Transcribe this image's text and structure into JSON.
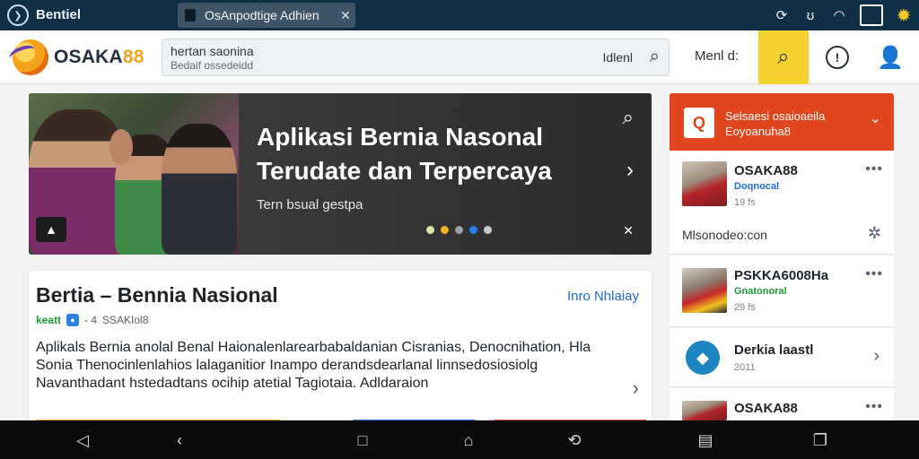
{
  "statusbar": {
    "app_name": "Bentiel",
    "tab_title": "OsAnpodtige Adhien",
    "tab_close": "✕"
  },
  "header": {
    "logo_main": "OSAKA",
    "logo_num": "88",
    "search_line1": "hertan saonina",
    "search_line2": "Bedaif ossedeidd",
    "search_label": "Idlenl",
    "menu_label": "Menl d:"
  },
  "hero": {
    "title": "Aplikasi Bernia Nasonal Terudate dan Terpercaya",
    "subtitle": "Tern bsual gestpa",
    "dot_colors": [
      "#d8e7b0",
      "#f2b31e",
      "#9aa3aa",
      "#2a7fe3",
      "#c7ccd1"
    ]
  },
  "article": {
    "title": "Bertia – Bennia Nasional",
    "more": "Inro Nhlaiay",
    "meta_tag": "keatt",
    "meta_sep": "- 4",
    "meta_source": "SSAKIol8",
    "body": "Aplikals Bernia anolal Benal Haionalenlarearbabaldanian Cisranias, Denocnihation, Hla Sonia Thenocinlenlahios lalaganitior Inampo derandsdearlanal linnsedosiosiolg Navanthadant hstedadtans ocihip atetial Tagiotaia. Adldaraion"
  },
  "sidebar": {
    "head_line1": "Selsaesi osaioaeila",
    "head_line2": "Eoyoanuha8",
    "cards": [
      {
        "title": "OSAKA88",
        "sub": "Doqnocal",
        "sub_color": "#1f6fd1",
        "time": "19 fs",
        "footer": "Mlsonodeo:con"
      },
      {
        "title": "PSKKA6008Ha",
        "sub": "Gnatonoral",
        "sub_color": "#1f9a3a",
        "time": "29 fs"
      },
      {
        "title": "Derkia laastl",
        "time": "2011"
      },
      {
        "title": "OSAKA88"
      }
    ]
  }
}
